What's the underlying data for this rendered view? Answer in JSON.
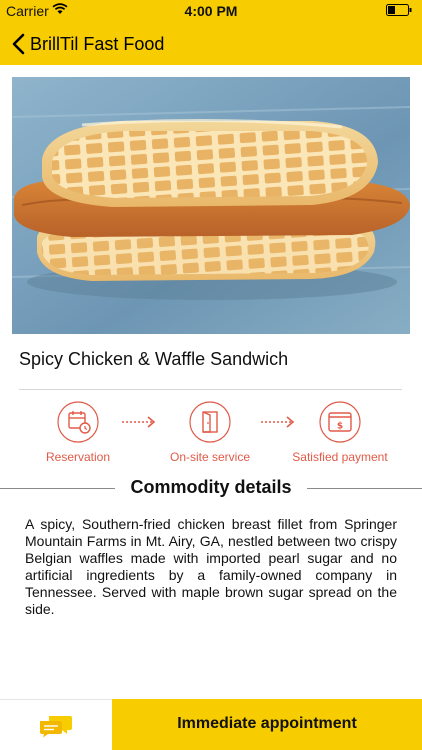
{
  "status_bar": {
    "carrier": "Carrier",
    "time": "4:00 PM"
  },
  "nav": {
    "title": "BrillTil Fast Food"
  },
  "product": {
    "title": "Spicy Chicken & Waffle Sandwich",
    "image": "chicken-waffle-sandwich-photo"
  },
  "steps": [
    {
      "label": "Reservation",
      "icon": "calendar-clock-icon"
    },
    {
      "label": "On-site service",
      "icon": "door-icon"
    },
    {
      "label": "Satisfied payment",
      "icon": "payment-icon"
    }
  ],
  "details": {
    "heading": "Commodity details",
    "text": "A spicy, Southern-fried chicken breast fillet from Springer Mountain Farms in Mt. Airy, GA, nestled between two crispy Belgian waffles made with imported pearl sugar and no artificial ingredients by a family-owned company in Tennessee. Served with maple brown sugar spread on the side."
  },
  "footer": {
    "button_label": "Immediate appointment",
    "chat_icon": "chat-bubbles-icon"
  },
  "colors": {
    "brand": "#f7cc00",
    "accent": "#e05a48"
  }
}
